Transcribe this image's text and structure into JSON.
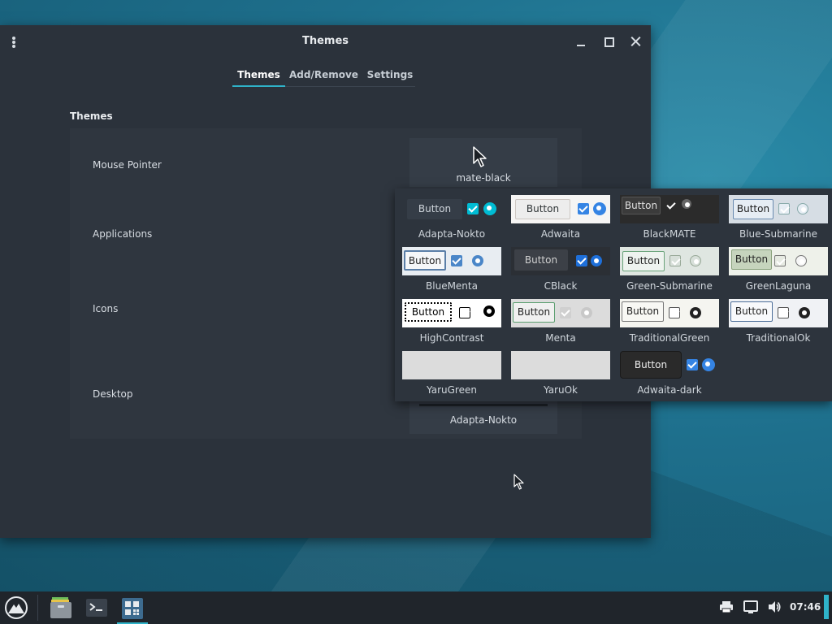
{
  "window": {
    "title": "Themes"
  },
  "tabs": [
    {
      "label": "Themes",
      "active": true
    },
    {
      "label": "Add/Remove",
      "active": false
    },
    {
      "label": "Settings",
      "active": false
    }
  ],
  "section": {
    "title": "Themes"
  },
  "rows": {
    "mouse_pointer": {
      "label": "Mouse Pointer",
      "value": "mate-black"
    },
    "applications": {
      "label": "Applications"
    },
    "icons": {
      "label": "Icons"
    },
    "desktop": {
      "label": "Desktop",
      "value": "Adapta-Nokto"
    }
  },
  "popup": {
    "button_text": "Button",
    "themes": [
      {
        "name": "Adapta-Nokto"
      },
      {
        "name": "Adwaita"
      },
      {
        "name": "BlackMATE"
      },
      {
        "name": "Blue-Submarine"
      },
      {
        "name": "BlueMenta"
      },
      {
        "name": "CBlack"
      },
      {
        "name": "Green-Submarine"
      },
      {
        "name": "GreenLaguna"
      },
      {
        "name": "HighContrast"
      },
      {
        "name": "Menta"
      },
      {
        "name": "TraditionalGreen"
      },
      {
        "name": "TraditionalOk"
      },
      {
        "name": "YaruGreen"
      },
      {
        "name": "YaruOk"
      },
      {
        "name": "Adwaita-dark"
      }
    ]
  },
  "taskbar": {
    "clock": "07:46",
    "apps": [
      "launcher-icon",
      "file-manager-icon",
      "terminal-icon",
      "themes-app-icon"
    ],
    "tray": [
      "printer-icon",
      "network-icon",
      "volume-icon"
    ]
  },
  "colors": {
    "accent": "#2fb3c9",
    "window_bg": "#2b323b",
    "taskbar_bg": "#20252b"
  }
}
